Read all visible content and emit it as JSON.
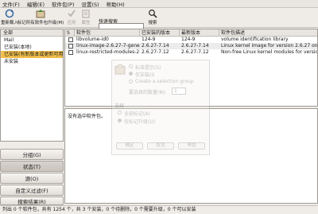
{
  "menubar": [
    "文件(F)",
    "编辑(E)",
    "软件包(P)",
    "设置(S)",
    "帮助(H)"
  ],
  "toolbar": {
    "reload": "重新载入",
    "mark_upgrades": "标记所有软件包升级(M)",
    "apply": "应用",
    "properties": "属性",
    "search_label": "快速搜索",
    "search_value": "",
    "search_button": "搜索"
  },
  "sidebar": {
    "header": "全部",
    "items": [
      "Mail",
      "已安装(本地)",
      "已安装(有新版本或更新可用)",
      "未安装"
    ],
    "buttons": [
      "分组(G)",
      "状态(T)",
      "源(O)",
      "自定义过滤(F)",
      "搜索结果(R)"
    ]
  },
  "table": {
    "headers": [
      "S",
      "软件包",
      "已安装的版本",
      "最新版本",
      "软件包描述"
    ],
    "rows": [
      {
        "name": "libvolume-id0",
        "installed": "124-9",
        "latest": "124-9",
        "desc": "volume identification library"
      },
      {
        "name": "linux-image-2.6.27-7-generic",
        "installed": "2.6.27-7.14",
        "latest": "2.6.27-7.14",
        "desc": "Linux kernel image for version 2.6.27 on x86/x86_64"
      },
      {
        "name": "linux-restricted-modules-2.6.27-7-generic",
        "installed": "2.6.27-7.12",
        "latest": "2.6.27-7.12",
        "desc": "Non-free Linux kernel modules for version 2.6.27"
      }
    ]
  },
  "description": {
    "text": "没有选中软件包。"
  },
  "dialog": {
    "radio1": "标准提示(S)",
    "radio2": "仅安装(I)",
    "radio3": "Create a selection group",
    "counter_label": "要选择的数量(N):",
    "counter_value": "1",
    "section_label": "选择",
    "check1": "全部标记(A)",
    "check2": "仅标记升级(U)",
    "btn_ok": "确定",
    "btn_cancel": "取消",
    "btn_help": "帮助"
  },
  "status": {
    "text": "列出 0 个软件包，共有 1254 个，共 3 个安装，0 个待删除，0 个需要升级，0 个可以安装"
  }
}
